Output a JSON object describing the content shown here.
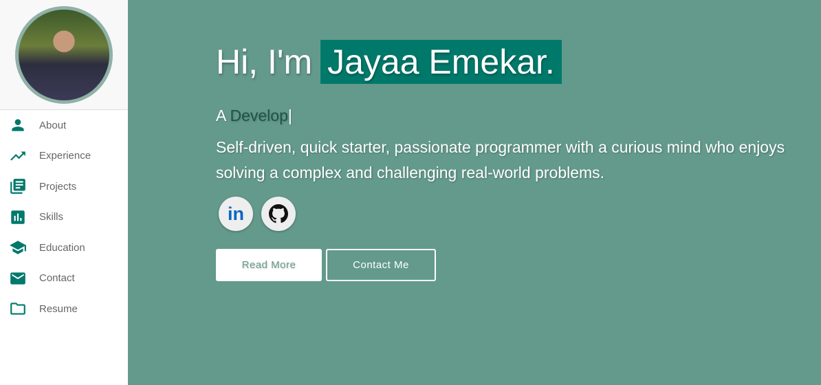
{
  "sidebar": {
    "avatar_alt": "profile photo",
    "items": [
      {
        "label": "About",
        "icon": "person-icon"
      },
      {
        "label": "Experience",
        "icon": "trending-up-icon"
      },
      {
        "label": "Projects",
        "icon": "library-books-icon"
      },
      {
        "label": "Skills",
        "icon": "bar-chart-icon"
      },
      {
        "label": "Education",
        "icon": "school-icon"
      },
      {
        "label": "Contact",
        "icon": "email-icon"
      },
      {
        "label": "Resume",
        "icon": "folder-icon"
      }
    ]
  },
  "hero": {
    "greeting": "Hi, I'm",
    "name": "Jayaa Emekar.",
    "role_prefix": "A",
    "role_typed": "Develop",
    "cursor": "|",
    "description": "Self-driven, quick starter, passionate programmer with a curious mind who enjoys solving a complex and challenging real-world problems.",
    "linkedin_label": "in",
    "read_more": "Read More",
    "contact_me": "Contact Me"
  },
  "colors": {
    "background": "#639a8b",
    "accent": "#00796b"
  }
}
